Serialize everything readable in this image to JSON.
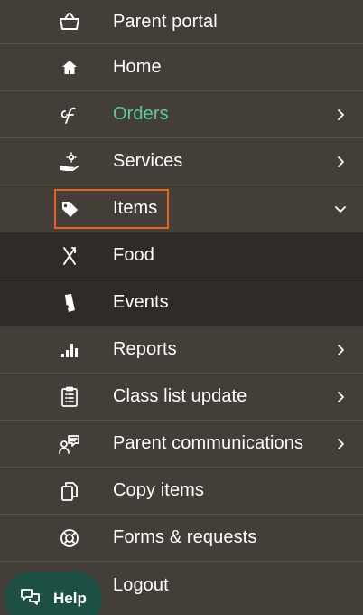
{
  "menu": {
    "items": [
      {
        "label": "Parent portal",
        "icon": "basket-icon"
      },
      {
        "label": "Home",
        "icon": "home-icon"
      },
      {
        "label": "Orders",
        "icon": "orders-logo-icon",
        "active": true,
        "submenu": "collapsed"
      },
      {
        "label": "Services",
        "icon": "hand-gear-icon",
        "submenu": "collapsed"
      },
      {
        "label": "Items",
        "icon": "tag-icon",
        "submenu": "expanded",
        "highlighted": true
      },
      {
        "label": "Food",
        "icon": "fork-knife-icon",
        "child": true
      },
      {
        "label": "Events",
        "icon": "ticket-icon",
        "child": true
      },
      {
        "label": "Reports",
        "icon": "bar-chart-icon",
        "submenu": "collapsed"
      },
      {
        "label": "Class list update",
        "icon": "clipboard-list-icon",
        "submenu": "collapsed"
      },
      {
        "label": "Parent communications",
        "icon": "users-chat-icon",
        "submenu": "collapsed"
      },
      {
        "label": "Copy items",
        "icon": "copy-icon"
      },
      {
        "label": "Forms & requests",
        "icon": "lifebuoy-icon"
      },
      {
        "label": "Logout",
        "icon": "logout-icon"
      }
    ]
  },
  "help": {
    "label": "Help",
    "icon": "chat-bubbles-icon"
  },
  "colors": {
    "background": "#433f38",
    "submenu_background": "#2f2c28",
    "active_text": "#5fc9a1",
    "highlight_border": "#e8621f",
    "help_button": "#1e4f45"
  }
}
